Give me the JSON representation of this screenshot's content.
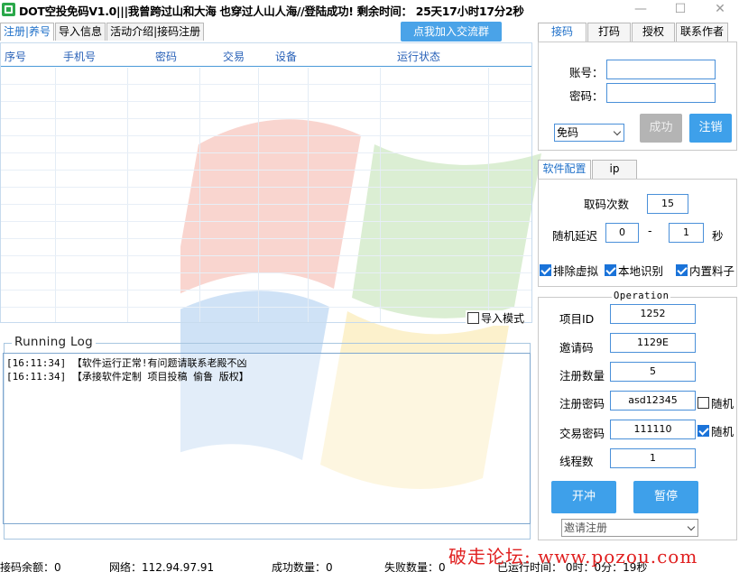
{
  "title": "DOT空投免码V1.0|||我曾跨过山和大海 也穿过人山人海//登陆成功! 剩余时间： 25天17小时17分2秒",
  "window_controls": {
    "minimize": "—",
    "maximize": "☐",
    "close": "✕"
  },
  "left_tabs": [
    {
      "label": "注册|养号",
      "active": true
    },
    {
      "label": "导入信息",
      "active": false
    },
    {
      "label": "活动介绍|接码注册",
      "active": false
    }
  ],
  "join_button": "点我加入交流群",
  "grid": {
    "columns": [
      "序号",
      "手机号",
      "密码",
      "交易",
      "设备",
      "运行状态"
    ]
  },
  "import_mode": {
    "label": "导入模式",
    "checked": false
  },
  "log": {
    "title": "Running Log",
    "lines": [
      "[16:11:34] 【软件运行正常!有问题请联系老殿不凶",
      "[16:11:34] 【承接软件定制 项目投稿 偷鲁 版权】"
    ]
  },
  "status": {
    "balance": "接码余额：0",
    "network": "网络：112.94.97.91",
    "success": "成功数量：0",
    "fail": "失败数量：0",
    "runtime": "已运行时间：  0时：0分：19秒"
  },
  "watermark": "破走论坛: www.pozou.com",
  "right_tabs": [
    {
      "label": "接码",
      "active": true
    },
    {
      "label": "打码",
      "active": false
    },
    {
      "label": "授权",
      "active": false
    },
    {
      "label": "联系作者",
      "active": false
    }
  ],
  "account": {
    "account_label": "账号：",
    "account_value": "",
    "password_label": "密码：",
    "password_value": "",
    "mode_select": "免码",
    "success_button": "成功",
    "logout_button": "注销"
  },
  "config_tabs": [
    {
      "label": "软件配置",
      "active": true
    },
    {
      "label": "ip",
      "active": false
    }
  ],
  "config": {
    "fetch_count_label": "取码次数",
    "fetch_count": "15",
    "delay_label": "随机延迟",
    "delay_min": "0",
    "delay_dash": "-",
    "delay_max": "1",
    "delay_unit": "秒",
    "exclude_virtual": {
      "label": "排除虚拟",
      "checked": true
    },
    "local_recognize": {
      "label": "本地识别",
      "checked": true
    },
    "builtin_material": {
      "label": "内置料子",
      "checked": true
    }
  },
  "operation": {
    "title": "Operation",
    "project_id_label": "项目ID",
    "project_id": "1252",
    "invite_code_label": "邀请码",
    "invite_code": "1129E",
    "register_count_label": "注册数量",
    "register_count": "5",
    "register_pwd_label": "注册密码",
    "register_pwd": "asd12345",
    "register_pwd_random": {
      "label": "随机",
      "checked": false
    },
    "trade_pwd_label": "交易密码",
    "trade_pwd": "111110",
    "trade_pwd_random": {
      "label": "随机",
      "checked": true
    },
    "threads_label": "线程数",
    "threads": "1",
    "start_button": "开冲",
    "pause_button": "暂停",
    "mode_select": "邀请注册"
  }
}
